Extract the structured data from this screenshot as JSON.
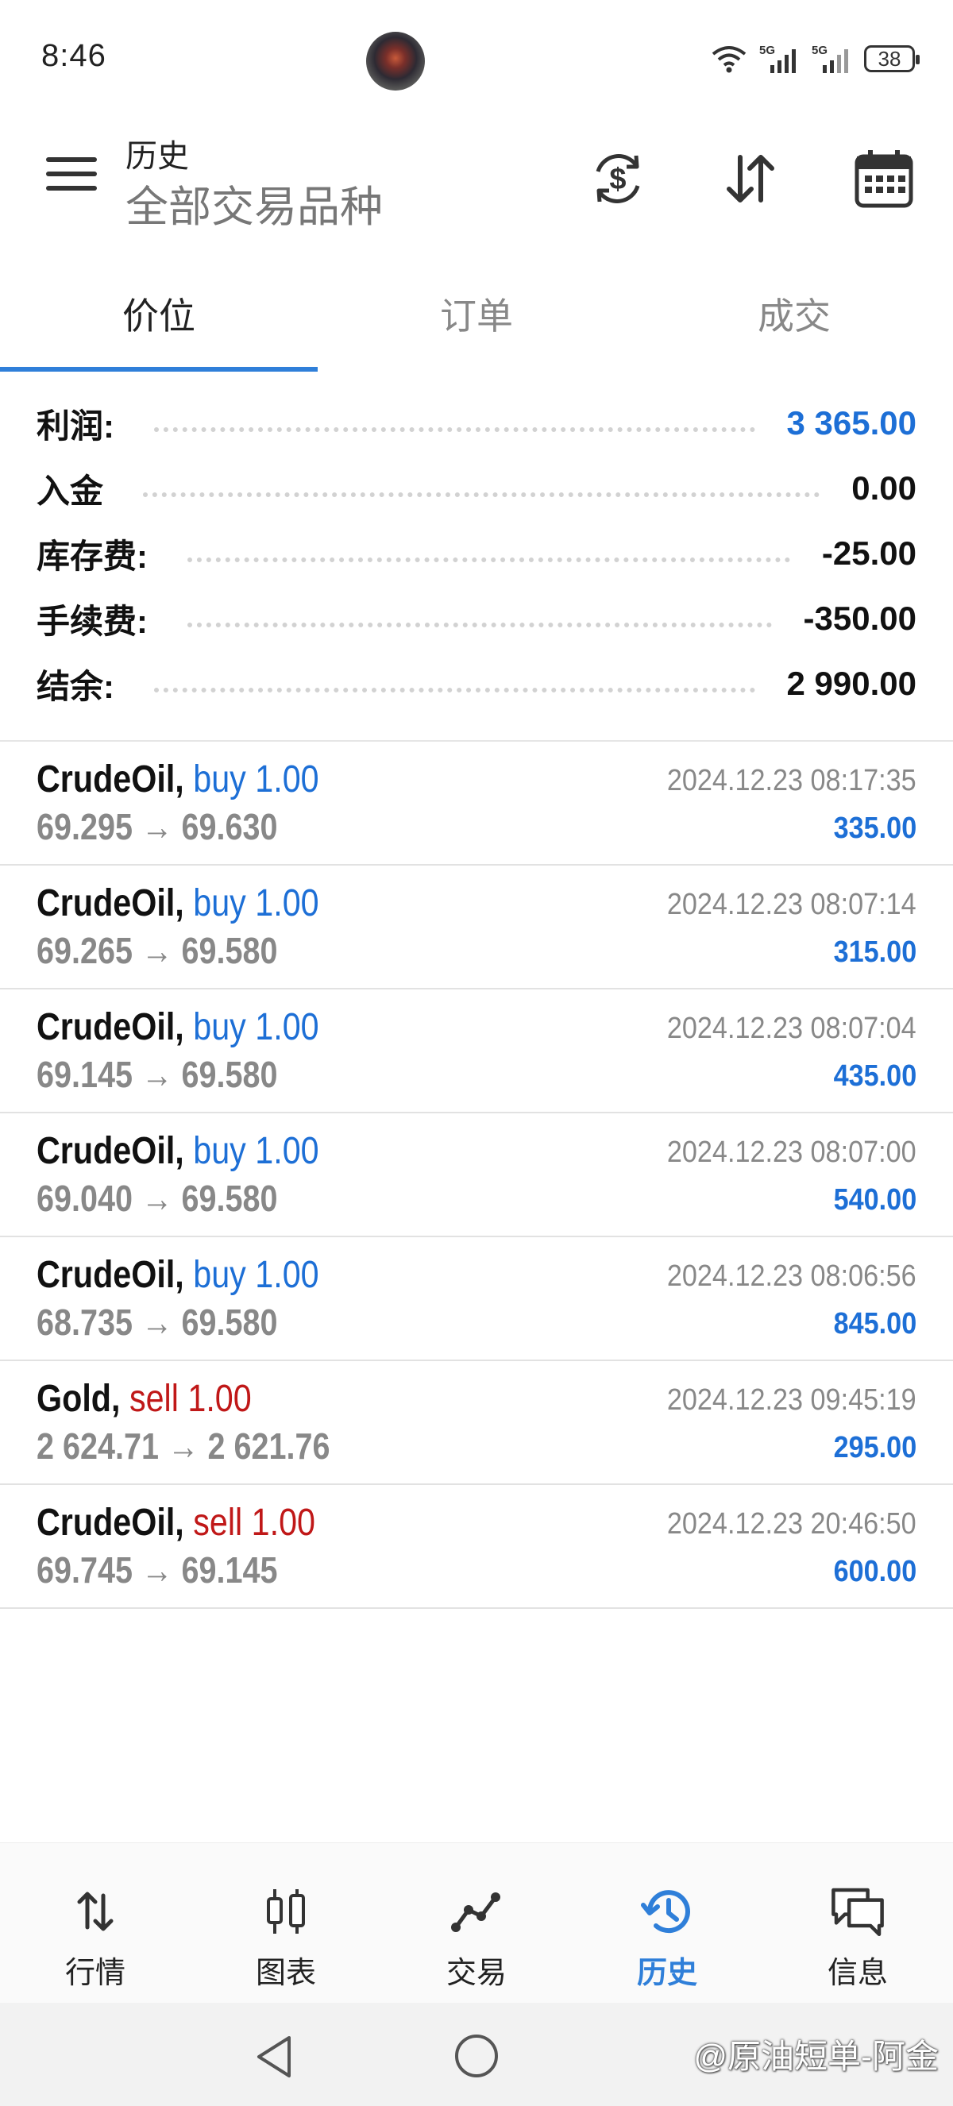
{
  "status_bar": {
    "time": "8:46",
    "signal1": "5G",
    "signal2": "5G",
    "battery": "38"
  },
  "toolbar": {
    "title": "历史",
    "subtitle": "全部交易品种"
  },
  "tabs": [
    {
      "label": "价位",
      "active": true
    },
    {
      "label": "订单",
      "active": false
    },
    {
      "label": "成交",
      "active": false
    }
  ],
  "summary": {
    "profit": {
      "label": "利润:",
      "value": "3 365.00"
    },
    "deposit": {
      "label": "入金",
      "value": "0.00"
    },
    "swap": {
      "label": "库存费:",
      "value": "-25.00"
    },
    "commission": {
      "label": "手续费:",
      "value": "-350.00"
    },
    "balance": {
      "label": "结余:",
      "value": "2 990.00"
    }
  },
  "deals": [
    {
      "symbol": "CrudeOil,",
      "side": "buy 1.00",
      "prices": "69.295 → 69.630",
      "time": "2024.12.23 08:17:35",
      "profit": "335.00"
    },
    {
      "symbol": "CrudeOil,",
      "side": "buy 1.00",
      "prices": "69.265 → 69.580",
      "time": "2024.12.23 08:07:14",
      "profit": "315.00"
    },
    {
      "symbol": "CrudeOil,",
      "side": "buy 1.00",
      "prices": "69.145 → 69.580",
      "time": "2024.12.23 08:07:04",
      "profit": "435.00"
    },
    {
      "symbol": "CrudeOil,",
      "side": "buy 1.00",
      "prices": "69.040 → 69.580",
      "time": "2024.12.23 08:07:00",
      "profit": "540.00"
    },
    {
      "symbol": "CrudeOil,",
      "side": "buy 1.00",
      "prices": "68.735 → 69.580",
      "time": "2024.12.23 08:06:56",
      "profit": "845.00"
    },
    {
      "symbol": "Gold,",
      "side": "sell 1.00",
      "prices": "2 624.71 → 2 621.76",
      "time": "2024.12.23 09:45:19",
      "profit": "295.00"
    },
    {
      "symbol": "CrudeOil,",
      "side": "sell 1.00",
      "prices": "69.745 → 69.145",
      "time": "2024.12.23 20:46:50",
      "profit": "600.00"
    }
  ],
  "bottom_nav": [
    {
      "label": "行情",
      "icon": "quotes-arrows-icon"
    },
    {
      "label": "图表",
      "icon": "candles-chart-icon"
    },
    {
      "label": "交易",
      "icon": "trade-line-icon"
    },
    {
      "label": "历史",
      "icon": "history-clock-icon"
    },
    {
      "label": "信息",
      "icon": "messages-icon"
    }
  ],
  "watermark": "@原油短单-阿金",
  "colors": {
    "accent": "#2f7fd9",
    "profit_blue": "#1d6fd6",
    "sell_red": "#c01818",
    "muted": "#888888"
  }
}
